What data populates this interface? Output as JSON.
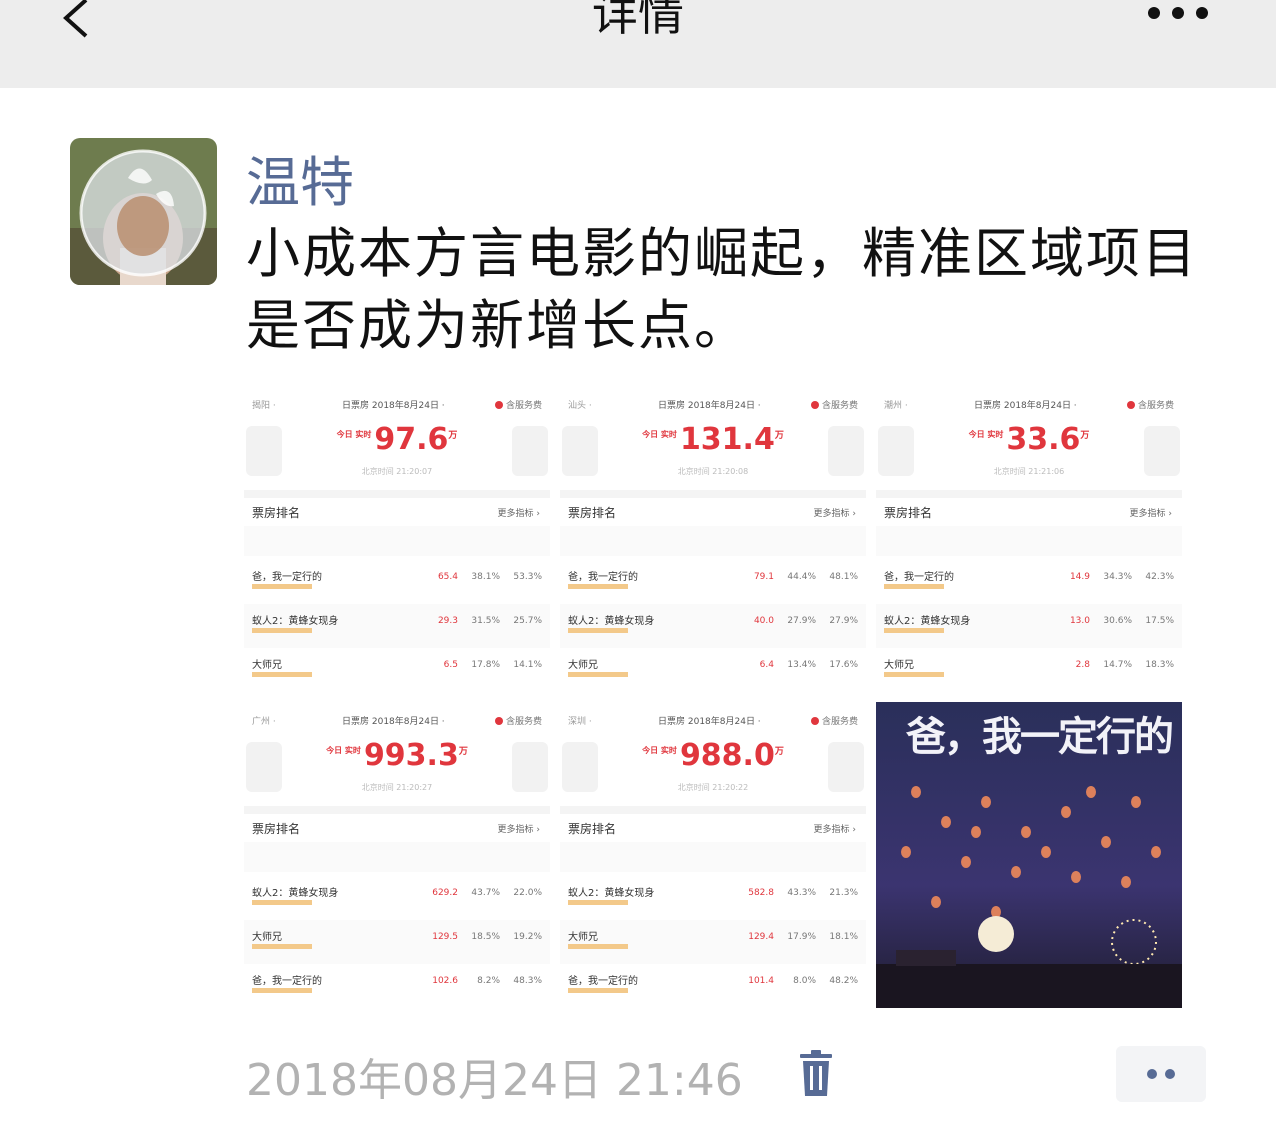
{
  "header": {
    "title": "详情"
  },
  "post": {
    "author": "温特",
    "text": "小成本方言电影的崛起，精准区域项目是否成为新增长点。",
    "time": "2018年08月24日 21:46"
  },
  "screenshots": [
    {
      "city": "揭阳 ·",
      "date": "日票房 2018年8月24日 ·",
      "service": "含服务费",
      "today": "今日 实时",
      "value": "97.6",
      "unit": "万",
      "updated": "北京时间 21:20:07",
      "rank_title": "票房排名",
      "more": "更多指标 ›",
      "rows": [
        {
          "film": "爸，我一定行的",
          "v1": "65.4",
          "v2": "38.1%",
          "v3": "53.3%"
        },
        {
          "film": "蚁人2：黄蜂女现身",
          "v1": "29.3",
          "v2": "31.5%",
          "v3": "25.7%"
        },
        {
          "film": "大师兄",
          "v1": "6.5",
          "v2": "17.8%",
          "v3": "14.1%"
        }
      ]
    },
    {
      "city": "汕头 ·",
      "date": "日票房 2018年8月24日 ·",
      "service": "含服务费",
      "today": "今日 实时",
      "value": "131.4",
      "unit": "万",
      "updated": "北京时间 21:20:08",
      "rank_title": "票房排名",
      "more": "更多指标 ›",
      "rows": [
        {
          "film": "爸，我一定行的",
          "v1": "79.1",
          "v2": "44.4%",
          "v3": "48.1%"
        },
        {
          "film": "蚁人2：黄蜂女现身",
          "v1": "40.0",
          "v2": "27.9%",
          "v3": "27.9%"
        },
        {
          "film": "大师兄",
          "v1": "6.4",
          "v2": "13.4%",
          "v3": "17.6%"
        }
      ]
    },
    {
      "city": "潮州 ·",
      "date": "日票房 2018年8月24日 ·",
      "service": "含服务费",
      "today": "今日 实时",
      "value": "33.6",
      "unit": "万",
      "updated": "北京时间 21:21:06",
      "rank_title": "票房排名",
      "more": "更多指标 ›",
      "rows": [
        {
          "film": "爸，我一定行的",
          "v1": "14.9",
          "v2": "34.3%",
          "v3": "42.3%"
        },
        {
          "film": "蚁人2：黄蜂女现身",
          "v1": "13.0",
          "v2": "30.6%",
          "v3": "17.5%"
        },
        {
          "film": "大师兄",
          "v1": "2.8",
          "v2": "14.7%",
          "v3": "18.3%"
        }
      ]
    },
    {
      "city": "广州 ·",
      "date": "日票房 2018年8月24日 ·",
      "service": "含服务费",
      "today": "今日 实时",
      "value": "993.3",
      "unit": "万",
      "updated": "北京时间 21:20:27",
      "rank_title": "票房排名",
      "more": "更多指标 ›",
      "rows": [
        {
          "film": "蚁人2：黄蜂女现身",
          "v1": "629.2",
          "v2": "43.7%",
          "v3": "22.0%"
        },
        {
          "film": "大师兄",
          "v1": "129.5",
          "v2": "18.5%",
          "v3": "19.2%"
        },
        {
          "film": "爸，我一定行的",
          "v1": "102.6",
          "v2": "8.2%",
          "v3": "48.3%"
        }
      ]
    },
    {
      "city": "深圳 ·",
      "date": "日票房 2018年8月24日 ·",
      "service": "含服务费",
      "today": "今日 实时",
      "value": "988.0",
      "unit": "万",
      "updated": "北京时间 21:20:22",
      "rank_title": "票房排名",
      "more": "更多指标 ›",
      "rows": [
        {
          "film": "蚁人2：黄蜂女现身",
          "v1": "582.8",
          "v2": "43.3%",
          "v3": "21.3%"
        },
        {
          "film": "大师兄",
          "v1": "129.4",
          "v2": "17.9%",
          "v3": "18.1%"
        },
        {
          "film": "爸，我一定行的",
          "v1": "101.4",
          "v2": "8.0%",
          "v3": "48.2%"
        }
      ]
    }
  ],
  "poster": {
    "title": "爸，我一定行的"
  },
  "colors": {
    "accent": "#576b95",
    "red": "#e0363d",
    "topbar": "#ededed"
  },
  "icons": {
    "back": "chevron-left-icon",
    "more": "ellipsis-icon",
    "delete": "trash-icon",
    "comment": "two-dots-icon"
  }
}
